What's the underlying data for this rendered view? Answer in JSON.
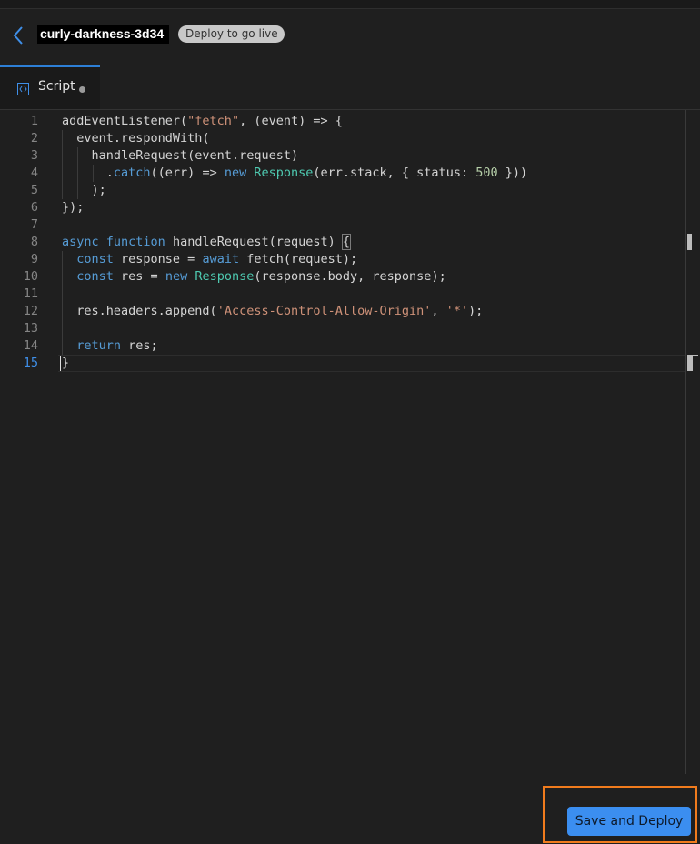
{
  "header": {
    "worker_name": "curly-darkness-3d34",
    "status_badge": "Deploy to go live"
  },
  "tabs": [
    {
      "label": "Script",
      "icon": "code-file-icon",
      "unsaved": true
    }
  ],
  "editor": {
    "active_line": "15",
    "lines": [
      {
        "n": "1",
        "tokens": [
          [
            "addEventListener(",
            "fn"
          ],
          [
            "\"fetch\"",
            "str"
          ],
          [
            ", (event) => {",
            "fn"
          ]
        ]
      },
      {
        "n": "2",
        "tokens": [
          [
            "  event.respondWith(",
            "fn"
          ]
        ]
      },
      {
        "n": "3",
        "tokens": [
          [
            "    handleRequest(event.request)",
            "fn"
          ]
        ]
      },
      {
        "n": "4",
        "tokens": [
          [
            "      .",
            "fn"
          ],
          [
            "catch",
            "kw"
          ],
          [
            "((err) => ",
            "fn"
          ],
          [
            "new",
            "kw"
          ],
          [
            " ",
            "fn"
          ],
          [
            "Response",
            "cls"
          ],
          [
            "(err.stack, { status: ",
            "fn"
          ],
          [
            "500",
            "num"
          ],
          [
            " }))",
            "fn"
          ]
        ]
      },
      {
        "n": "5",
        "tokens": [
          [
            "    );",
            "fn"
          ]
        ]
      },
      {
        "n": "6",
        "tokens": [
          [
            "});",
            "fn"
          ]
        ]
      },
      {
        "n": "7",
        "tokens": []
      },
      {
        "n": "8",
        "tokens": [
          [
            "async",
            "kw"
          ],
          [
            " ",
            "fn"
          ],
          [
            "function",
            "kw"
          ],
          [
            " handleRequest(request) ",
            "fn"
          ],
          [
            "{",
            "fn"
          ]
        ]
      },
      {
        "n": "9",
        "tokens": [
          [
            "  ",
            "fn"
          ],
          [
            "const",
            "kw"
          ],
          [
            " response = ",
            "fn"
          ],
          [
            "await",
            "kw"
          ],
          [
            " fetch(request);",
            "fn"
          ]
        ]
      },
      {
        "n": "10",
        "tokens": [
          [
            "  ",
            "fn"
          ],
          [
            "const",
            "kw"
          ],
          [
            " res = ",
            "fn"
          ],
          [
            "new",
            "kw"
          ],
          [
            " ",
            "fn"
          ],
          [
            "Response",
            "cls"
          ],
          [
            "(response.body, response);",
            "fn"
          ]
        ]
      },
      {
        "n": "11",
        "tokens": []
      },
      {
        "n": "12",
        "tokens": [
          [
            "  res.headers.append(",
            "fn"
          ],
          [
            "'Access-Control-Allow-Origin'",
            "str"
          ],
          [
            ", ",
            "fn"
          ],
          [
            "'*'",
            "str"
          ],
          [
            ");",
            "fn"
          ]
        ]
      },
      {
        "n": "13",
        "tokens": []
      },
      {
        "n": "14",
        "tokens": [
          [
            "  ",
            "fn"
          ],
          [
            "return",
            "kw"
          ],
          [
            " res;",
            "fn"
          ]
        ]
      },
      {
        "n": "15",
        "tokens": [
          [
            "}",
            "fn"
          ]
        ]
      }
    ]
  },
  "footer": {
    "deploy_label": "Save and Deploy"
  },
  "colors": {
    "background": "#1f1f1f",
    "accent": "#3b8ef0",
    "highlight": "#f07b1d",
    "keyword": "#569cd6",
    "string": "#ce9178",
    "number": "#b5cea8",
    "class": "#4ec9b0"
  }
}
